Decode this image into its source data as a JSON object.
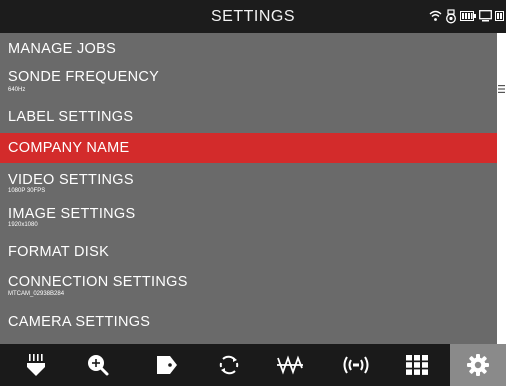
{
  "header": {
    "title": "SETTINGS"
  },
  "menu": {
    "items": [
      {
        "label": "MANAGE JOBS",
        "sub": ""
      },
      {
        "label": "SONDE FREQUENCY",
        "sub": "640Hz"
      },
      {
        "label": "LABEL SETTINGS",
        "sub": ""
      },
      {
        "label": "COMPANY NAME",
        "sub": "",
        "selected": true
      },
      {
        "label": "VIDEO SETTINGS",
        "sub": "1080P 30FPS"
      },
      {
        "label": "IMAGE SETTINGS",
        "sub": "1920x1080"
      },
      {
        "label": "FORMAT DISK",
        "sub": ""
      },
      {
        "label": "CONNECTION SETTINGS",
        "sub": "MTCAM_02938B284"
      },
      {
        "label": "CAMERA SETTINGS",
        "sub": ""
      }
    ]
  },
  "colors": {
    "menu_bg": "#6a6a6a",
    "selected": "#d32b2b",
    "header_bg": "#1c1c1c",
    "toolbar_active": "#8a8a8a"
  },
  "toolbar": {
    "icons": [
      "sonde-icon",
      "zoom-in-icon",
      "tag-icon",
      "rotate-icon",
      "sonde-locate-icon",
      "transmit-icon",
      "grid-icon",
      "settings-gear-icon"
    ],
    "active": "settings-gear-icon"
  }
}
